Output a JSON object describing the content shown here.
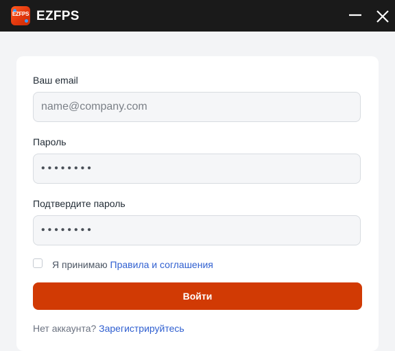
{
  "app": {
    "title": "EZFPS",
    "logo_text": "EZFPS",
    "colors": {
      "titlebar": "#1a1a1a",
      "accent": "#d13a04",
      "link": "#2f5fd0"
    }
  },
  "window_controls": {
    "minimize_icon": "minimize-icon",
    "close_icon": "close-icon"
  },
  "form": {
    "email": {
      "label": "Ваш email",
      "placeholder": "name@company.com",
      "value": ""
    },
    "password": {
      "label": "Пароль",
      "placeholder": "••••••••",
      "value": ""
    },
    "confirm_password": {
      "label": "Подтвердите пароль",
      "placeholder": "••••••••",
      "value": ""
    },
    "terms": {
      "text": "Я принимаю",
      "link": "Правила и соглашения",
      "checked": false
    },
    "submit_label": "Войти",
    "register": {
      "text": "Нет аккаунта?",
      "link": "Зарегистрируйтесь"
    }
  }
}
